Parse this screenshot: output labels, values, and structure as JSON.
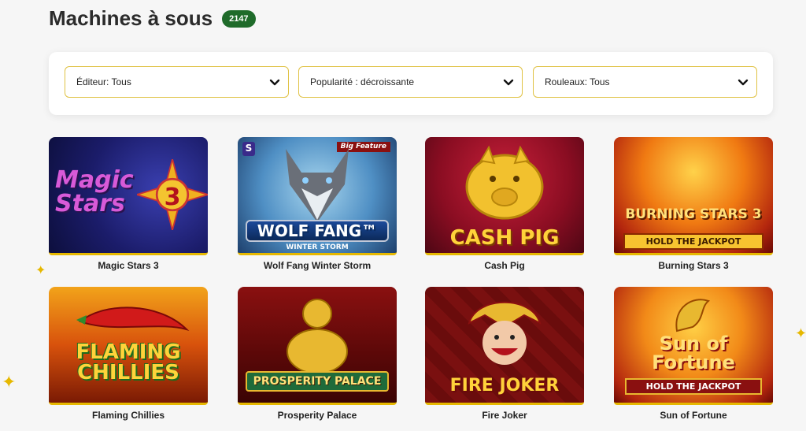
{
  "page": {
    "title": "Machines à sous",
    "count": "2147"
  },
  "filters": [
    {
      "label": "Éditeur: Tous"
    },
    {
      "label": "Popularité : décroissante"
    },
    {
      "label": "Rouleaux: Tous"
    }
  ],
  "games": [
    {
      "name": "Magic Stars 3",
      "art_text": "Magic Stars",
      "art_extra": "3"
    },
    {
      "name": "Wolf Fang Winter Storm",
      "art_text": "WOLF FANG™",
      "art_extra": "WINTER STORM",
      "badge": "Big Feature",
      "provider_mark": "S"
    },
    {
      "name": "Cash Pig",
      "art_text": "CASH PIG"
    },
    {
      "name": "Burning Stars 3",
      "art_text": "BURNING STARS 3",
      "art_extra": "HOLD THE JACKPOT"
    },
    {
      "name": "Flaming Chillies",
      "art_text": "FLAMING CHILLIES"
    },
    {
      "name": "Prosperity Palace",
      "art_text": "PROSPERITY PALACE"
    },
    {
      "name": "Fire Joker",
      "art_text": "FIRE JOKER"
    },
    {
      "name": "Sun of Fortune",
      "art_text": "Sun of Fortune",
      "art_extra": "HOLD THE JACKPOT"
    }
  ],
  "colors": {
    "accent_gold": "#e6b800",
    "badge_green": "#1f6b2a"
  }
}
